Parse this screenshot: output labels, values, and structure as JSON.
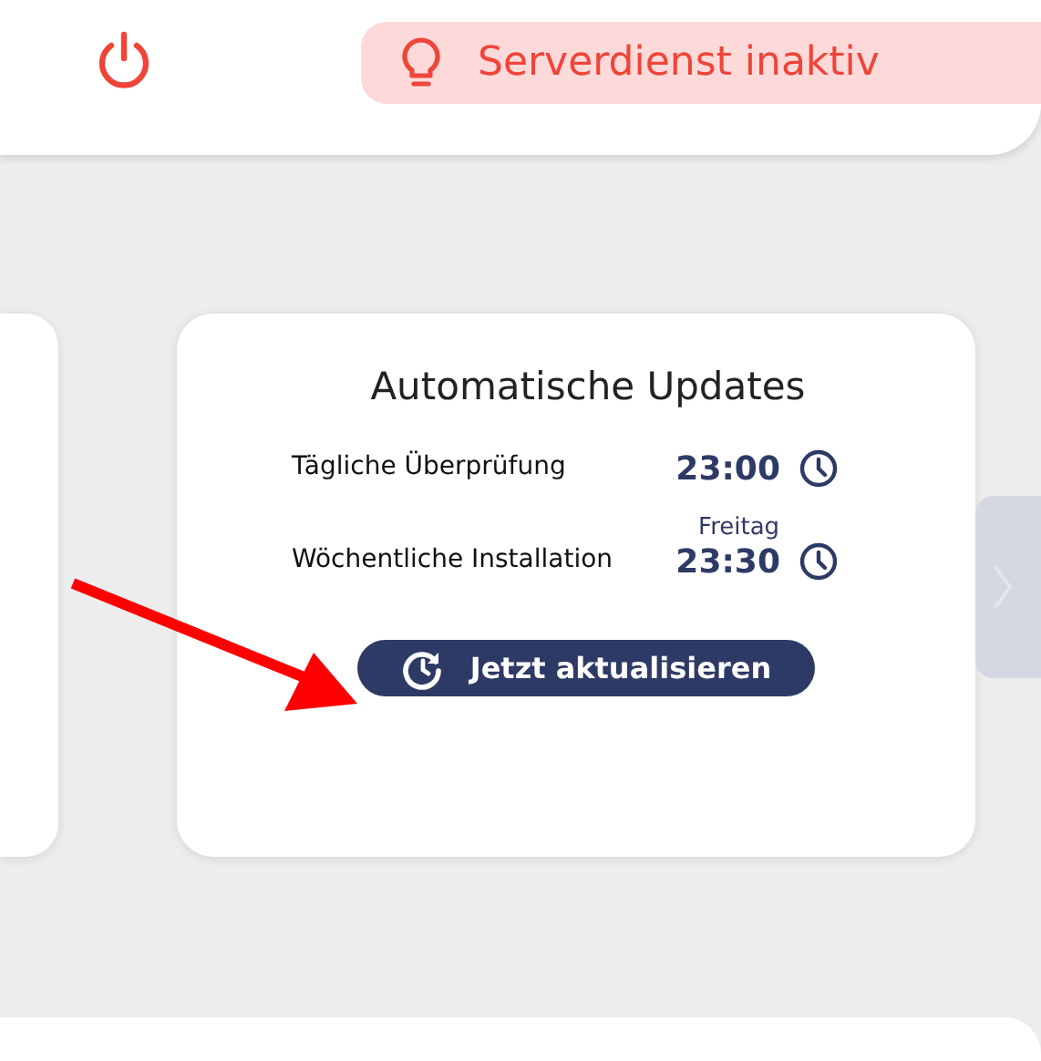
{
  "header": {
    "status": {
      "text": "Serverdienst inaktiv",
      "active": false
    }
  },
  "updates_card": {
    "title": "Automatische Updates",
    "rows": [
      {
        "label": "Tägliche Überprüfung",
        "time": "23:00"
      },
      {
        "label": "Wöchentliche Installation",
        "day": "Freitag",
        "time": "23:30"
      }
    ],
    "button": "Jetzt aktualisieren"
  }
}
